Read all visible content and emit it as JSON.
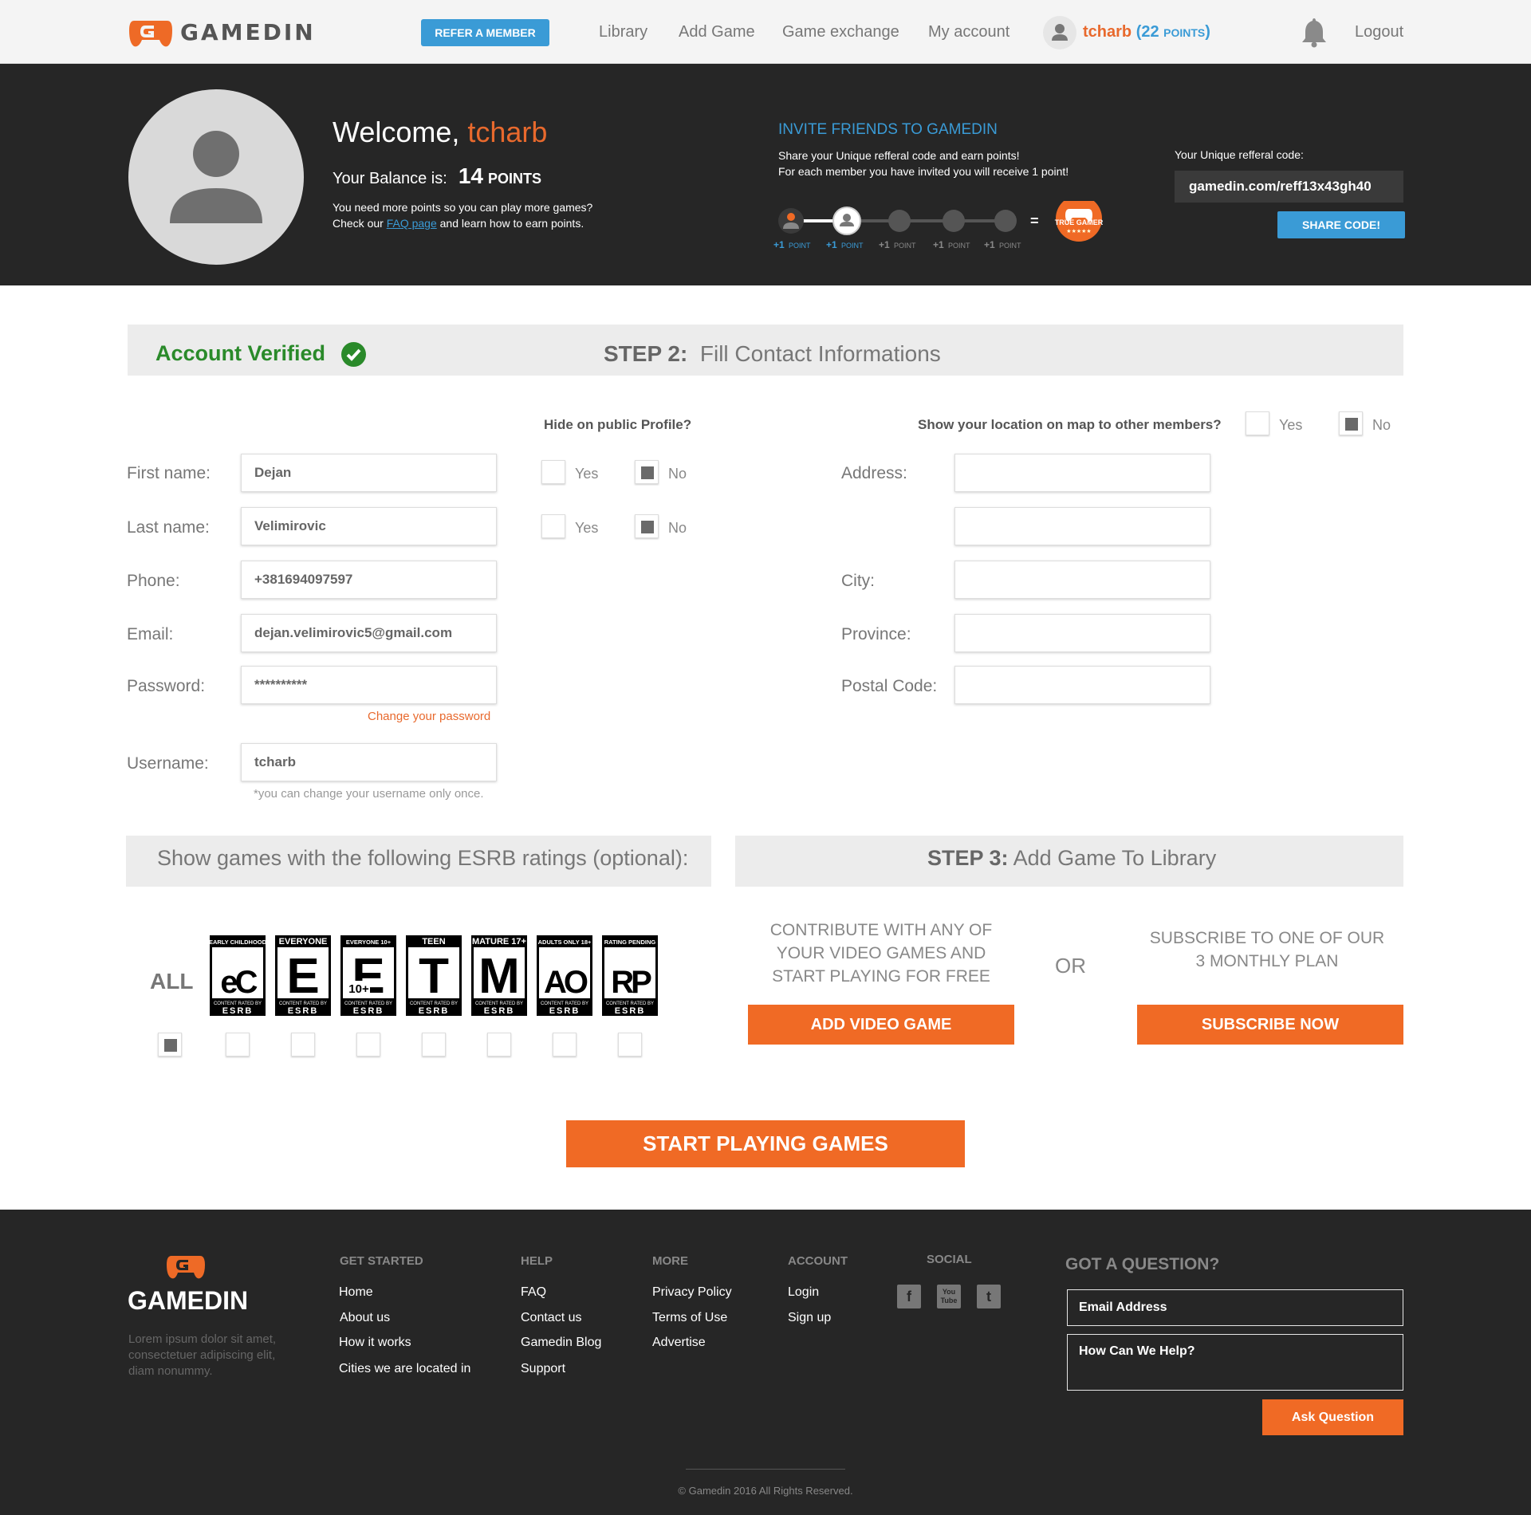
{
  "header": {
    "brand": "GAMEDIN",
    "refer_button": "REFER A MEMBER",
    "nav": [
      "Library",
      "Add Game",
      "Game exchange",
      "My account"
    ],
    "user": {
      "name": "tcharb",
      "points_open": "(22 ",
      "points_unit": "POINTS",
      "points_close": ")"
    },
    "logout": "Logout"
  },
  "hero": {
    "welcome_prefix": "Welcome, ",
    "username": "tcharb",
    "balance_label": "Your Balance is:",
    "balance_value": "14",
    "balance_unit": "POINTS",
    "note_line1": "You need more points so you can play more games?",
    "note_line2_pre": "Check our ",
    "note_link": "FAQ page",
    "note_line2_post": " and learn how to earn points.",
    "invite_title": "INVITE FRIENDS TO GAMEDIN",
    "invite_line1": "Share your Unique refferal code and earn points!",
    "invite_line2": "For each member you have invited you will receive 1 point!",
    "step_plus": "+1",
    "step_point": "POINT",
    "equals": "=",
    "badge_text": "TRUE GAMER",
    "badge_stars": "★★★★★",
    "invites_completed": 2,
    "invites_total": 5,
    "ref_label": "Your Unique refferal code:",
    "ref_code": "gamedin.com/reff13x43gh40",
    "share_button": "SHARE CODE!"
  },
  "step_bar": {
    "verified": "Account Verified",
    "step2_bold": "STEP 2:",
    "step2_text": "Fill Contact Informations"
  },
  "form": {
    "hide_question": "Hide on public Profile?",
    "location_question": "Show your location on map to other members?",
    "yes": "Yes",
    "no": "No",
    "first_name": {
      "label": "First name:",
      "value": "Dejan"
    },
    "last_name": {
      "label": "Last name:",
      "value": "Velimirovic"
    },
    "phone": {
      "label": "Phone:",
      "value": "+381694097597"
    },
    "email": {
      "label": "Email:",
      "value": "dejan.velimirovic5@gmail.com"
    },
    "password": {
      "label": "Password:",
      "value": "**********"
    },
    "change_password": "Change your password",
    "username": {
      "label": "Username:",
      "value": "tcharb"
    },
    "username_note": "*you can change your username only once.",
    "address_label": "Address:",
    "city_label": "City:",
    "province_label": "Province:",
    "postal_label": "Postal Code:"
  },
  "esrb": {
    "title": "Show games with the following ESRB ratings (optional):",
    "all": "ALL",
    "ratings": [
      {
        "top": "EARLY CHILDHOOD",
        "letter": "eC"
      },
      {
        "top": "EVERYONE",
        "letter": "E"
      },
      {
        "top": "EVERYONE 10+",
        "letter": "E"
      },
      {
        "top": "TEEN",
        "letter": "T"
      },
      {
        "top": "MATURE 17+",
        "letter": "M"
      },
      {
        "top": "ADULTS ONLY 18+",
        "letter": "AO"
      },
      {
        "top": "RATING PENDING",
        "letter": "RP"
      }
    ],
    "footer_small": "CONTENT RATED BY",
    "footer_big": "ESRB",
    "ten_plus": "10+"
  },
  "step3": {
    "bold": "STEP 3:",
    "text": "Add Game To Library",
    "contribute": "CONTRIBUTE WITH ANY OF YOUR VIDEO GAMES AND START PLAYING FOR FREE",
    "or": "OR",
    "subscribe": "SUBSCRIBE TO ONE OF OUR 3 MONTHLY PLAN",
    "add_button": "ADD VIDEO GAME",
    "subscribe_button": "SUBSCRIBE NOW"
  },
  "start_button": "START PLAYING GAMES",
  "footer": {
    "brand": "GAMEDIN",
    "about": "Lorem ipsum dolor sit amet, consectetuer adipiscing elit, diam nonummy.",
    "columns": [
      {
        "heading": "GET STARTED",
        "links": [
          "Home",
          "About us",
          "How it works",
          "Cities we are located in"
        ]
      },
      {
        "heading": "HELP",
        "links": [
          "FAQ",
          "Contact us",
          "Gamedin Blog",
          "Support"
        ]
      },
      {
        "heading": "MORE",
        "links": [
          "Privacy Policy",
          "Terms of Use",
          "Advertise"
        ]
      },
      {
        "heading": "ACCOUNT",
        "links": [
          "Login",
          "Sign up"
        ]
      }
    ],
    "social_heading": "SOCIAL",
    "social": {
      "facebook": "f",
      "youtube": "You Tube",
      "twitter": "t"
    },
    "question_heading": "GOT A QUESTION?",
    "email_placeholder": "Email Address",
    "help_placeholder": "How Can We Help?",
    "ask_button": "Ask Question",
    "copyright": "© Gamedin 2016 All Rights Reserved."
  },
  "colors": {
    "accent": "#f06a25",
    "blue": "#3a9bd6",
    "dark": "#262626",
    "verified": "#2a8a2a"
  }
}
